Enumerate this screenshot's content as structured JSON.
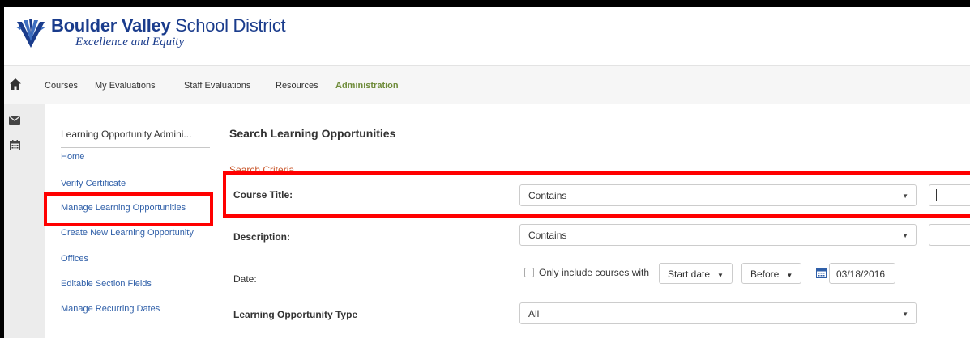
{
  "brand": {
    "name_bold": "Boulder Valley",
    "name_regular": " School District",
    "tagline": "Excellence and Equity",
    "color": "#1a3c8c"
  },
  "nav": {
    "items": [
      {
        "label": "Courses"
      },
      {
        "label": "My Evaluations"
      },
      {
        "label": "Staff Evaluations"
      },
      {
        "label": "Resources"
      },
      {
        "label": "Administration",
        "active": true
      }
    ],
    "active_color": "#6f8c3a"
  },
  "rail": {
    "icons": [
      "envelope-icon",
      "calendar-icon"
    ]
  },
  "sidebar": {
    "title": "Learning Opportunity Admini...",
    "links": [
      {
        "label": "Home"
      },
      {
        "label": "Verify Certificate"
      },
      {
        "label": "Manage Learning Opportunities"
      },
      {
        "label": "Create New Learning Opportunity"
      },
      {
        "label": "Offices"
      },
      {
        "label": "Editable Section Fields"
      },
      {
        "label": "Manage Recurring Dates"
      }
    ],
    "link_color": "#2f5fa8"
  },
  "main": {
    "title": "Search Learning Opportunities",
    "criteria_heading": "Search Criteria",
    "rows": {
      "course_title": {
        "label": "Course Title:",
        "operator": "Contains",
        "value": ""
      },
      "description": {
        "label": "Description:",
        "operator": "Contains",
        "value": ""
      },
      "date": {
        "label": "Date:",
        "checkbox_label": "Only include courses with",
        "checked": false,
        "date_field": "Start date",
        "comparison": "Before",
        "date_value": "03/18/2016"
      },
      "type": {
        "label": "Learning Opportunity Type",
        "value": "All"
      }
    }
  },
  "highlight_color": "#ff0000"
}
